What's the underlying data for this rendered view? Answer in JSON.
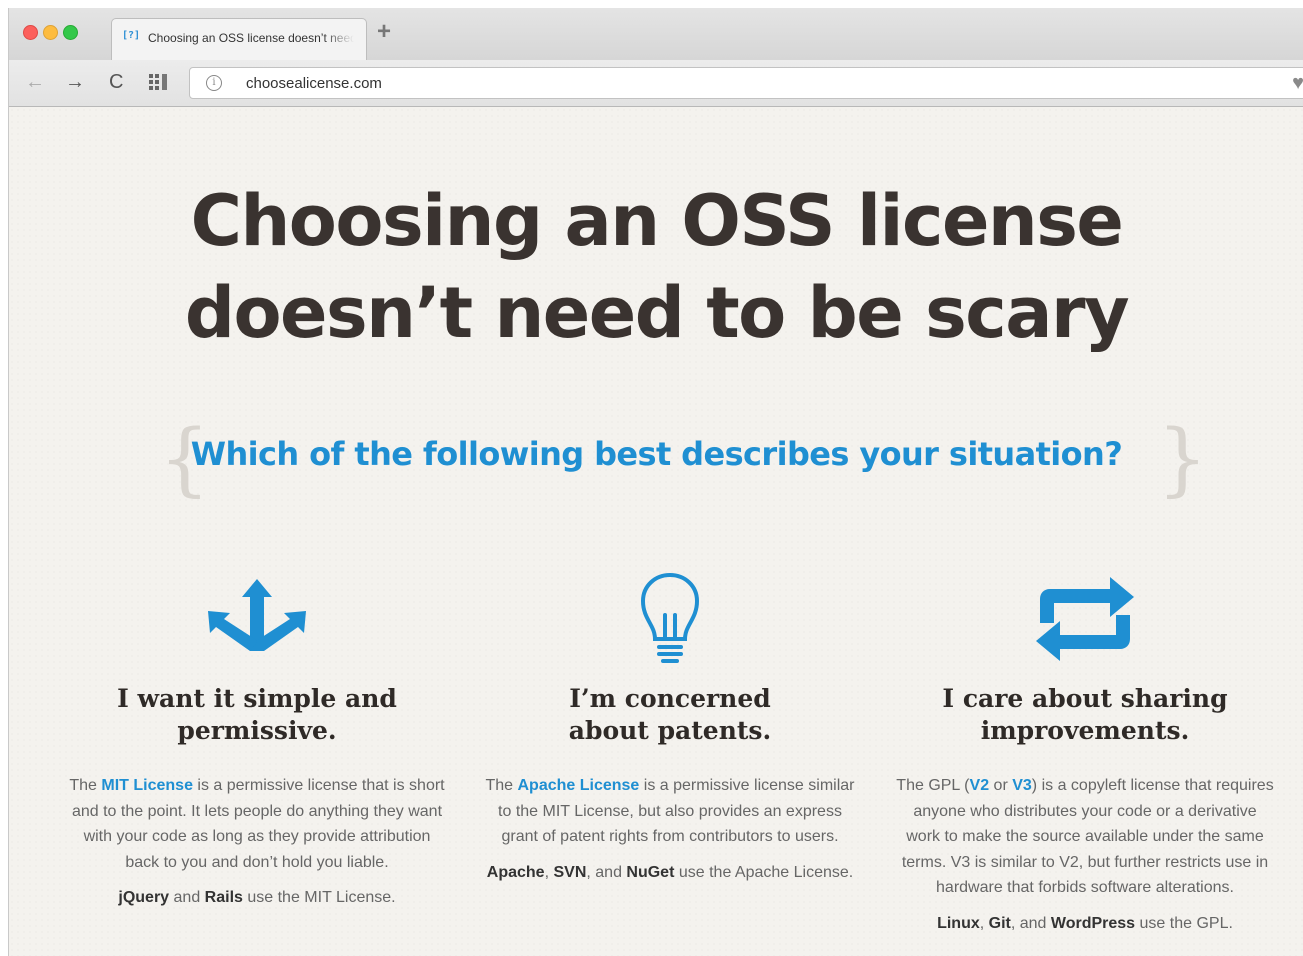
{
  "browser": {
    "tab": {
      "favicon": "[?]",
      "title": "Choosing an OSS license doesn’t need to be scary"
    },
    "new_tab_label": "+",
    "nav": {
      "back": "←",
      "forward": "→",
      "reload": "C"
    },
    "url": "choosealicense.com",
    "icons": [
      "back-arrow-icon",
      "forward-arrow-icon",
      "reload-icon",
      "apps-grid-icon",
      "info-icon",
      "heart-icon"
    ]
  },
  "hero": {
    "line1": "Choosing an OSS license",
    "line2": "doesn’t need to be scary"
  },
  "question": {
    "bracket_left": "{",
    "text": "Which of the following best describes your situation?",
    "bracket_right": "}"
  },
  "accent_color": "#1f8fd2",
  "columns": [
    {
      "icon": "arrows-fork-icon",
      "heading_line1": "I want it simple and",
      "heading_line2": "permissive.",
      "p1_a": "The ",
      "p1_link": "MIT License",
      "p1_b": " is a permissive license that is short and to the point. It lets people do anything they want with your code as long as they provide attribution back to you and don’t hold you liable.",
      "p2_s1": "jQuery",
      "p2_t1": " and ",
      "p2_s2": "Rails",
      "p2_t2": " use the MIT License."
    },
    {
      "icon": "lightbulb-icon",
      "heading_line1": "I’m concerned",
      "heading_line2": "about patents.",
      "p1_a": "The ",
      "p1_link": "Apache License",
      "p1_b": " is a permissive license similar to the MIT License, but also provides an express grant of patent rights from contributors to users.",
      "p2_s1": "Apache",
      "p2_t1": ", ",
      "p2_s2": "SVN",
      "p2_t2": ", and ",
      "p2_s3": "NuGet",
      "p2_t3": " use the Apache License."
    },
    {
      "icon": "repeat-arrows-icon",
      "heading_line1": "I care about sharing",
      "heading_line2": "improvements.",
      "p1_a": "The GPL (",
      "p1_link": "V2",
      "p1_mid": " or ",
      "p1_link2": "V3",
      "p1_b": ") is a copyleft license that requires anyone who distributes your code or a derivative work to make the source available under the same terms. V3 is similar to V2, but further restricts use in hardware that forbids software alterations.",
      "p2_s1": "Linux",
      "p2_t1": ", ",
      "p2_s2": "Git",
      "p2_t2": ", and ",
      "p2_s3": "WordPress",
      "p2_t3": " use the GPL."
    }
  ]
}
